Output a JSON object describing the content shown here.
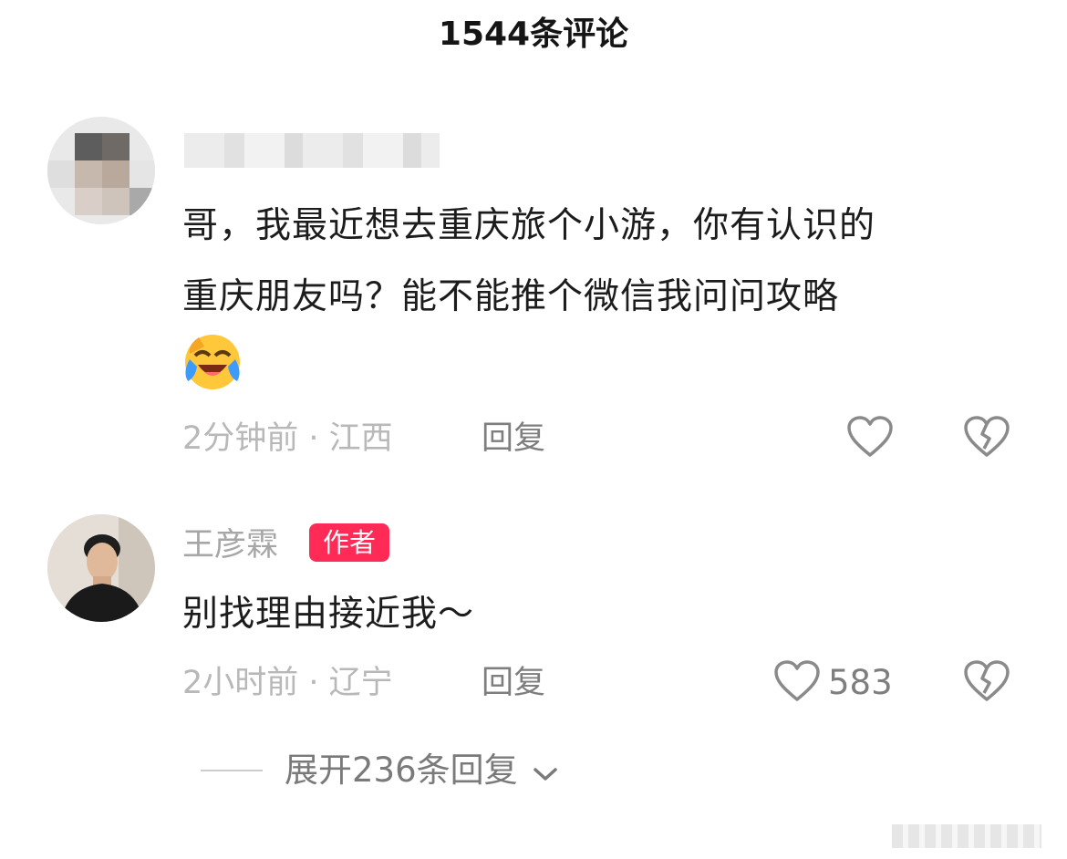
{
  "header": {
    "title": "1544条评论"
  },
  "comments": [
    {
      "text_line1": "哥，我最近想去重庆旅个小游，你有认识的",
      "text_line2": "重庆朋友吗？能不能推个微信我问问攻略",
      "emoji": "😭",
      "time_location": "2分钟前 · 江西",
      "reply_label": "回复"
    },
    {
      "author": "王彦霖",
      "badge": "作者",
      "text": "别找理由接近我～",
      "time_location": "2小时前 · 辽宁",
      "reply_label": "回复",
      "like_count": "583"
    }
  ],
  "expand": {
    "label": "展开236条回复"
  },
  "colors": {
    "badge": "#ff2a55",
    "meta_text": "#b8b8b8",
    "icon": "#888888",
    "emoji_face": "#ffc83a",
    "emoji_tears": "#3d9bff"
  },
  "icons": [
    "heart-outline-icon",
    "broken-heart-icon",
    "chevron-down-icon",
    "laughing-crying-emoji"
  ]
}
